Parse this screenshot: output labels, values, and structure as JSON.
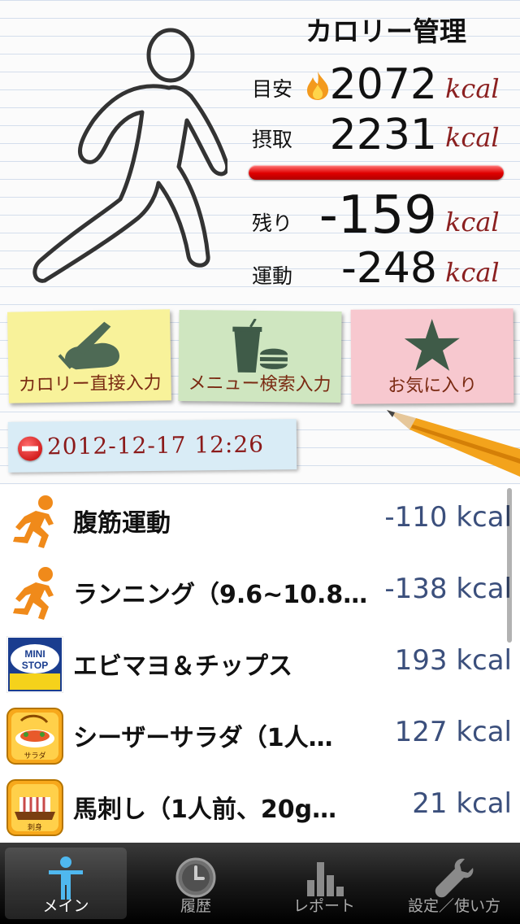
{
  "header": {
    "title": "カロリー管理",
    "target_label": "目安",
    "target_value": "2072",
    "intake_label": "摂取",
    "intake_value": "2231",
    "remaining_label": "残り",
    "remaining_value": "-159",
    "exercise_label": "運動",
    "exercise_value": "-248",
    "unit": "kcal",
    "progress_percent": 100
  },
  "actions": {
    "direct_input": "カロリー直接入力",
    "menu_search": "メニュー検索入力",
    "favorites": "お気に入り"
  },
  "date_tag": {
    "text": "2012-12-17 12:26",
    "icon": "minus-circle-icon"
  },
  "entries": [
    {
      "name": "腹筋運動",
      "kcal": "-110 kcal",
      "icon": "runner-icon"
    },
    {
      "name": "ランニング（9.6~10.8…",
      "kcal": "-138 kcal",
      "icon": "runner-icon"
    },
    {
      "name": "エビマヨ＆チップス",
      "kcal": "193 kcal",
      "icon": "ministop-logo",
      "logo_text": [
        "MINI",
        "STOP"
      ]
    },
    {
      "name": "シーザーサラダ（1人…",
      "kcal": "127 kcal",
      "icon": "salad-icon",
      "icon_caption": "サラダ"
    },
    {
      "name": "馬刺し（1人前、20g…",
      "kcal": "21 kcal",
      "icon": "sashimi-icon",
      "icon_caption": "刺身"
    }
  ],
  "tabbar": {
    "tabs": [
      {
        "label": "メイン",
        "icon": "person-icon",
        "active": true
      },
      {
        "label": "履歴",
        "icon": "clock-icon",
        "active": false
      },
      {
        "label": "レポート",
        "icon": "bar-chart-icon",
        "active": false
      },
      {
        "label": "設定／使い方",
        "icon": "wrench-icon",
        "active": false
      }
    ]
  },
  "colors": {
    "progress": "#e00000",
    "unit": "#8b2020",
    "kcal_value": "#3b4f7c",
    "runner": "#f08a1a",
    "note_yellow": "#f8f29a",
    "note_green": "#cfe6c0",
    "note_pink": "#f7c8cf"
  }
}
